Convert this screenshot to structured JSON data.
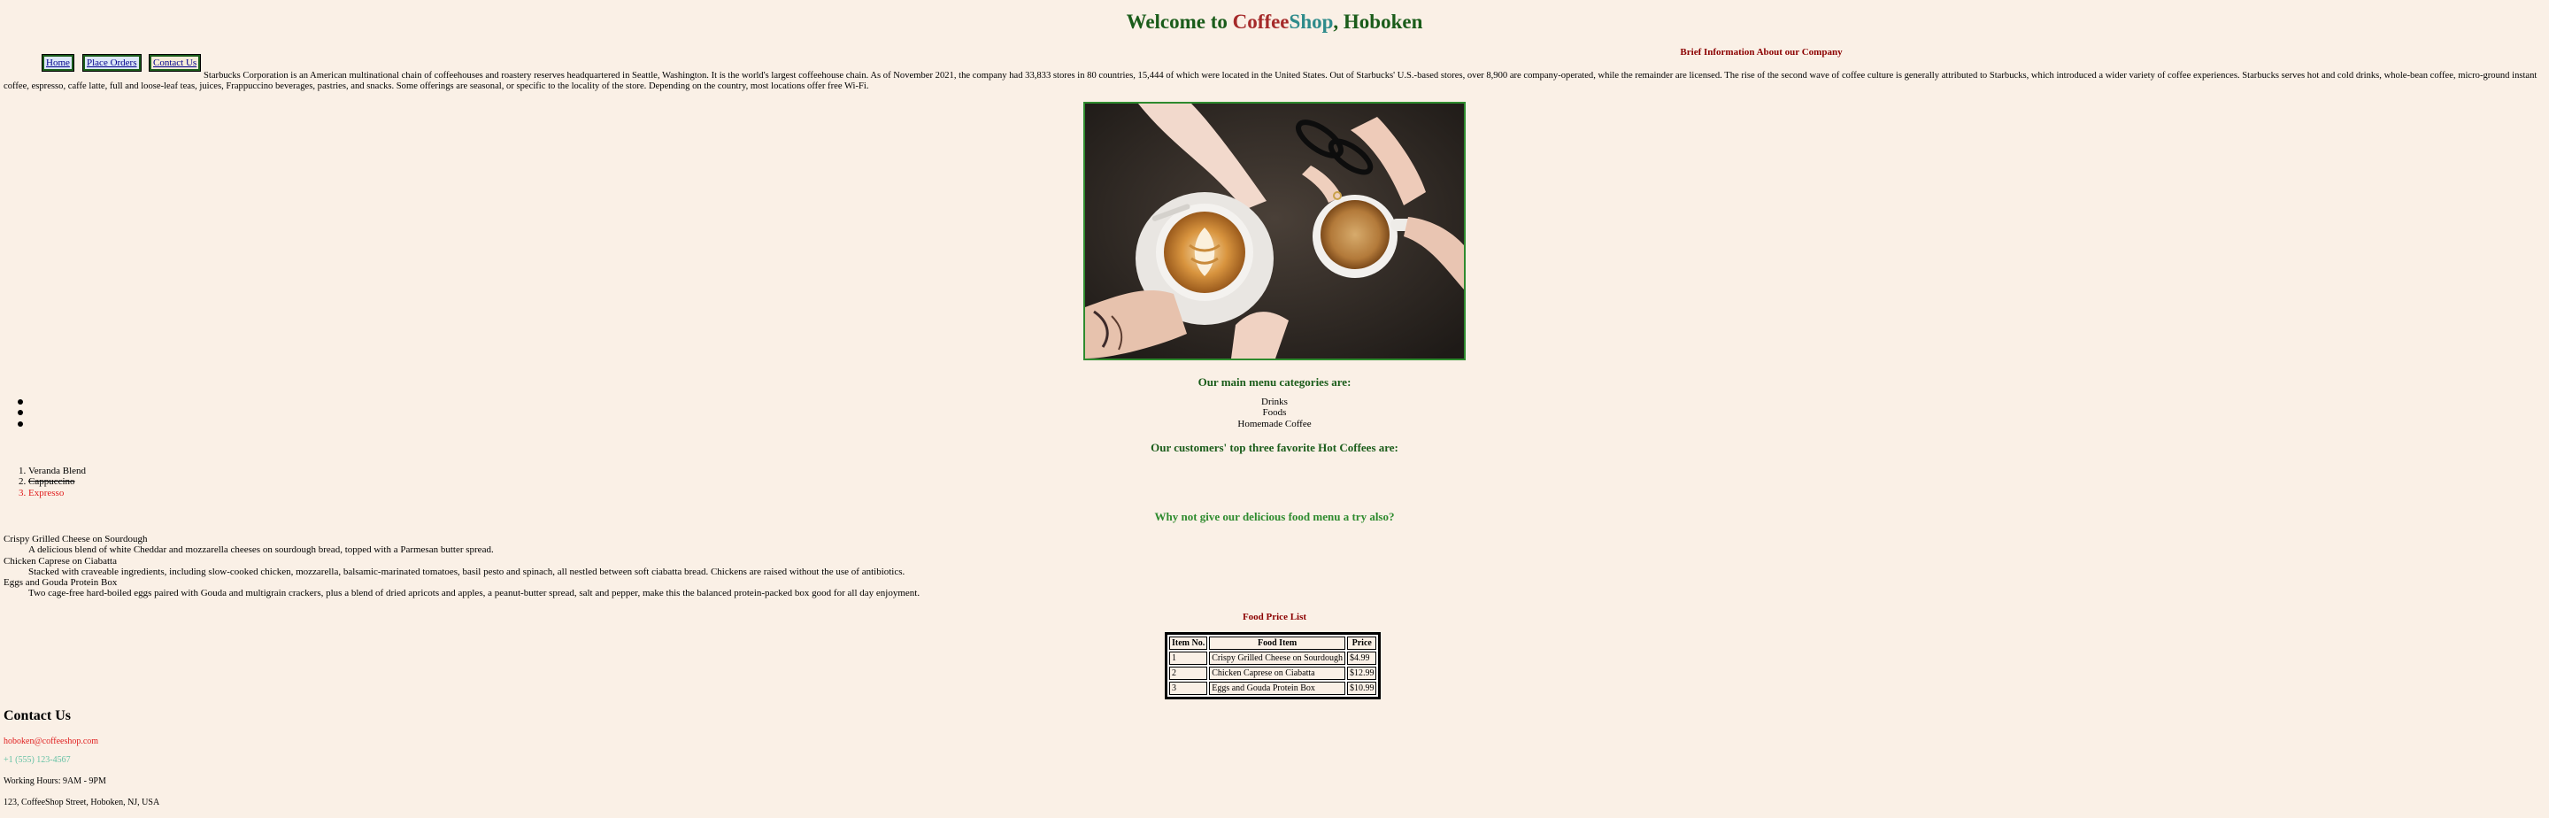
{
  "header": {
    "title_prefix": "Welcome to ",
    "title_coffee": "Coffee",
    "title_shop": "Shop",
    "title_suffix": ", Hoboken"
  },
  "nav": {
    "home": "Home",
    "orders": "Place Orders",
    "contact": "Contact Us"
  },
  "about": {
    "heading": "Brief Information About our Company",
    "text": "Starbucks Corporation is an American multinational chain of coffeehouses and roastery reserves headquartered in Seattle, Washington. It is the world's largest coffeehouse chain. As of November 2021, the company had 33,833 stores in 80 countries, 15,444 of which were located in the United States. Out of Starbucks' U.S.-based stores, over 8,900 are company-operated, while the remainder are licensed. The rise of the second wave of coffee culture is generally attributed to Starbucks, which introduced a wider variety of coffee experiences. Starbucks serves hot and cold drinks, whole-bean coffee, micro-ground instant coffee, espresso, caffe latte, full and loose-leaf teas, juices, Frappuccino beverages, pastries, and snacks. Some offerings are seasonal, or specific to the locality of the store. Depending on the country, most locations offer free Wi-Fi."
  },
  "categories": {
    "heading": "Our main menu categories are:",
    "items": [
      "Drinks",
      "Foods",
      "Homemade Coffee"
    ]
  },
  "favorites": {
    "heading": "Our customers' top three favorite Hot Coffees are:",
    "items": [
      "Veranda Blend",
      "Cappuccino",
      "Expresso"
    ]
  },
  "food": {
    "heading": "Why not give our delicious food menu a try also?",
    "items": [
      {
        "name": "Crispy Grilled Cheese on Sourdough",
        "desc": "A delicious blend of white Cheddar and mozzarella cheeses on sourdough bread, topped with a Parmesan butter spread."
      },
      {
        "name": "Chicken Caprese on Ciabatta",
        "desc": "Stacked with craveable ingredients, including slow-cooked chicken, mozzarella, balsamic-marinated tomatoes, basil pesto and spinach, all nestled between soft ciabatta bread. Chickens are raised without the use of antibiotics."
      },
      {
        "name": "Eggs and Gouda Protein Box",
        "desc": "Two cage-free hard-boiled eggs paired with Gouda and multigrain crackers, plus a blend of dried apricots and apples, a peanut-butter spread, salt and pepper, make this the balanced protein-packed box good for all day enjoyment."
      }
    ]
  },
  "price_list": {
    "heading": "Food Price List",
    "columns": [
      "Item No.",
      "Food Item",
      "Price"
    ],
    "rows": [
      [
        "1",
        "Crispy Grilled Cheese on Sourdough",
        "$4.99"
      ],
      [
        "2",
        "Chicken Caprese on Ciabatta",
        "$12.99"
      ],
      [
        "3",
        "Eggs and Gouda Protein Box",
        "$10.99"
      ]
    ]
  },
  "contact": {
    "heading": "Contact Us",
    "email": "hoboken@coffeeshop.com",
    "phone": "+1 (555) 123-4567",
    "hours": "Working Hours: 9AM - 9PM",
    "address": "123, CoffeeShop Street, Hoboken, NJ, USA"
  },
  "colors": {
    "background": "#faf0e6",
    "title_green": "#1a5c1a",
    "coffee_brown": "#a52a2a",
    "shop_teal": "#2e8b8b",
    "heading_maroon": "#8b0000",
    "heading_green": "#2e8b2e",
    "expresso_red": "#e02020"
  }
}
